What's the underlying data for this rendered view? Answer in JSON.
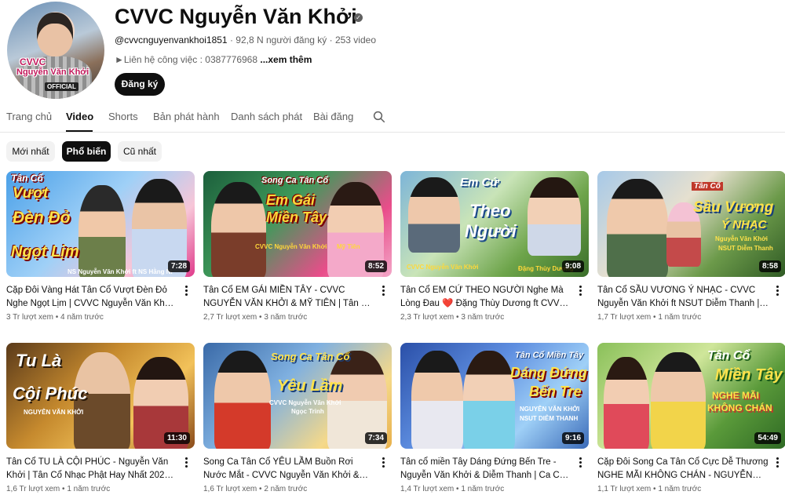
{
  "channel": {
    "name": "CVVC Nguyễn Văn Khởi",
    "handle": "@cvvcnguyenvankhoi1851",
    "subscribers": "92,8 N người đăng ký",
    "video_count": "253 video",
    "description": "►Liên hệ công việc : 0387776968",
    "more_label": "...xem thêm",
    "subscribe_label": "Đăng ký",
    "avatar_text": [
      "CVVC",
      "Nguyễn Văn Khởi",
      "OFFICIAL"
    ],
    "verified_icon": "check-icon"
  },
  "tabs": [
    "Trang chủ",
    "Video",
    "Shorts",
    "Bản phát hành",
    "Danh sách phát",
    "Bài đăng"
  ],
  "active_tab": "Video",
  "chips": [
    "Mới nhất",
    "Phổ biến",
    "Cũ nhất"
  ],
  "active_chip": "Phổ biến",
  "colors": {
    "accent": "#0f0f0f",
    "secondary_text": "#606060",
    "chip_bg": "#f2f2f2"
  },
  "videos": [
    {
      "title": "Cặp Đôi Vàng Hát Tân Cổ Vượt Đèn Đỏ Nghe Ngọt Lịm | CVVC Nguyễn Văn Khởi ft NS...",
      "views": "3 Tr lượt xem",
      "age": "4 năm trước",
      "duration": "7:28",
      "thumb_text": [
        "Tân Cổ",
        "Vượt",
        "Đèn Đỏ",
        "Ngọt Lịm",
        "NS Nguyễn Văn Khởi ft NS Hằng Ni"
      ]
    },
    {
      "title": "Tân Cổ EM GÁI MIỀN TÂY - CVVC NGUYỄN VĂN KHỞI & MỸ TIÊN | Tân Cổ Miền Tây Ha...",
      "views": "2,7 Tr lượt xem",
      "age": "3 năm trước",
      "duration": "8:52",
      "thumb_text": [
        "Song Ca Tân Cổ",
        "Em Gái Miền Tây",
        "CVVC Nguyễn Văn Khởi",
        "Mỹ Tiên"
      ]
    },
    {
      "title": "Tân Cổ EM CỨ THEO NGƯỜI Nghe Mà Lòng Đau ❤️ Đặng Thùy Dương ft CVVC Nguyễn...",
      "views": "2,3 Tr lượt xem",
      "age": "3 năm trước",
      "duration": "9:08",
      "thumb_text": [
        "Em Cứ",
        "Theo",
        "Người",
        "CVVC Nguyễn Văn Khởi",
        "Đặng Thùy Dương"
      ]
    },
    {
      "title": "Tân Cổ SẦU VƯƠNG Ý NHẠC - CVVC Nguyễn Văn Khởi ft NSUT Diễm Thanh | Nghe Buồn...",
      "views": "1,7 Tr lượt xem",
      "age": "1 năm trước",
      "duration": "8:58",
      "thumb_text": [
        "Tân Cổ",
        "Sầu Vương",
        "Ý NHẠC",
        "Nguyễn Văn Khởi",
        "NSUT Diễm Thanh"
      ]
    },
    {
      "title": "Tân Cổ TU LÀ CỘI PHÚC - Nguyễn Văn Khởi | Tân Cổ Nhạc Phật Hay Nhất 2024 LH...",
      "views": "1,6 Tr lượt xem",
      "age": "1 năm trước",
      "duration": "11:30",
      "thumb_text": [
        "Tu Là",
        "Cội Phúc",
        "NGUYỄN VĂN KHỞI"
      ]
    },
    {
      "title": "Song Ca Tân Cổ YÊU LẦM Buồn Rơi Nước Mắt - CVVC Nguyễn Văn Khởi & Ngọc Trinh...",
      "views": "1,6 Tr lượt xem",
      "age": "2 năm trước",
      "duration": "7:34",
      "thumb_text": [
        "Song Ca Tân Cổ",
        "Yêu Lầm",
        "CVVC Nguyễn Văn Khởi",
        "Ngọc Trinh"
      ]
    },
    {
      "title": "Tân cổ miền Tây Dáng Đứng Bến Tre - Nguyễn Văn Khởi & Diễm Thanh | Ca Cổ Mi...",
      "views": "1,4 Tr lượt xem",
      "age": "1 năm trước",
      "duration": "9:16",
      "thumb_text": [
        "Tân Cổ Miền Tây",
        "Dáng Đứng",
        "Bến Tre",
        "NGUYỄN VĂN KHỞI",
        "NSUT DIỄM THANH"
      ]
    },
    {
      "title": "Cặp Đôi Song Ca Tân Cổ Cực Dễ Thương NGHE MÃI KHÔNG CHÁN - NGUYỄN VĂN...",
      "views": "1,1 Tr lượt xem",
      "age": "1 năm trước",
      "duration": "54:49",
      "thumb_text": [
        "Tân Cổ",
        "Miền Tây",
        "NGHE MÃI",
        "KHÔNG CHÁN"
      ]
    }
  ]
}
